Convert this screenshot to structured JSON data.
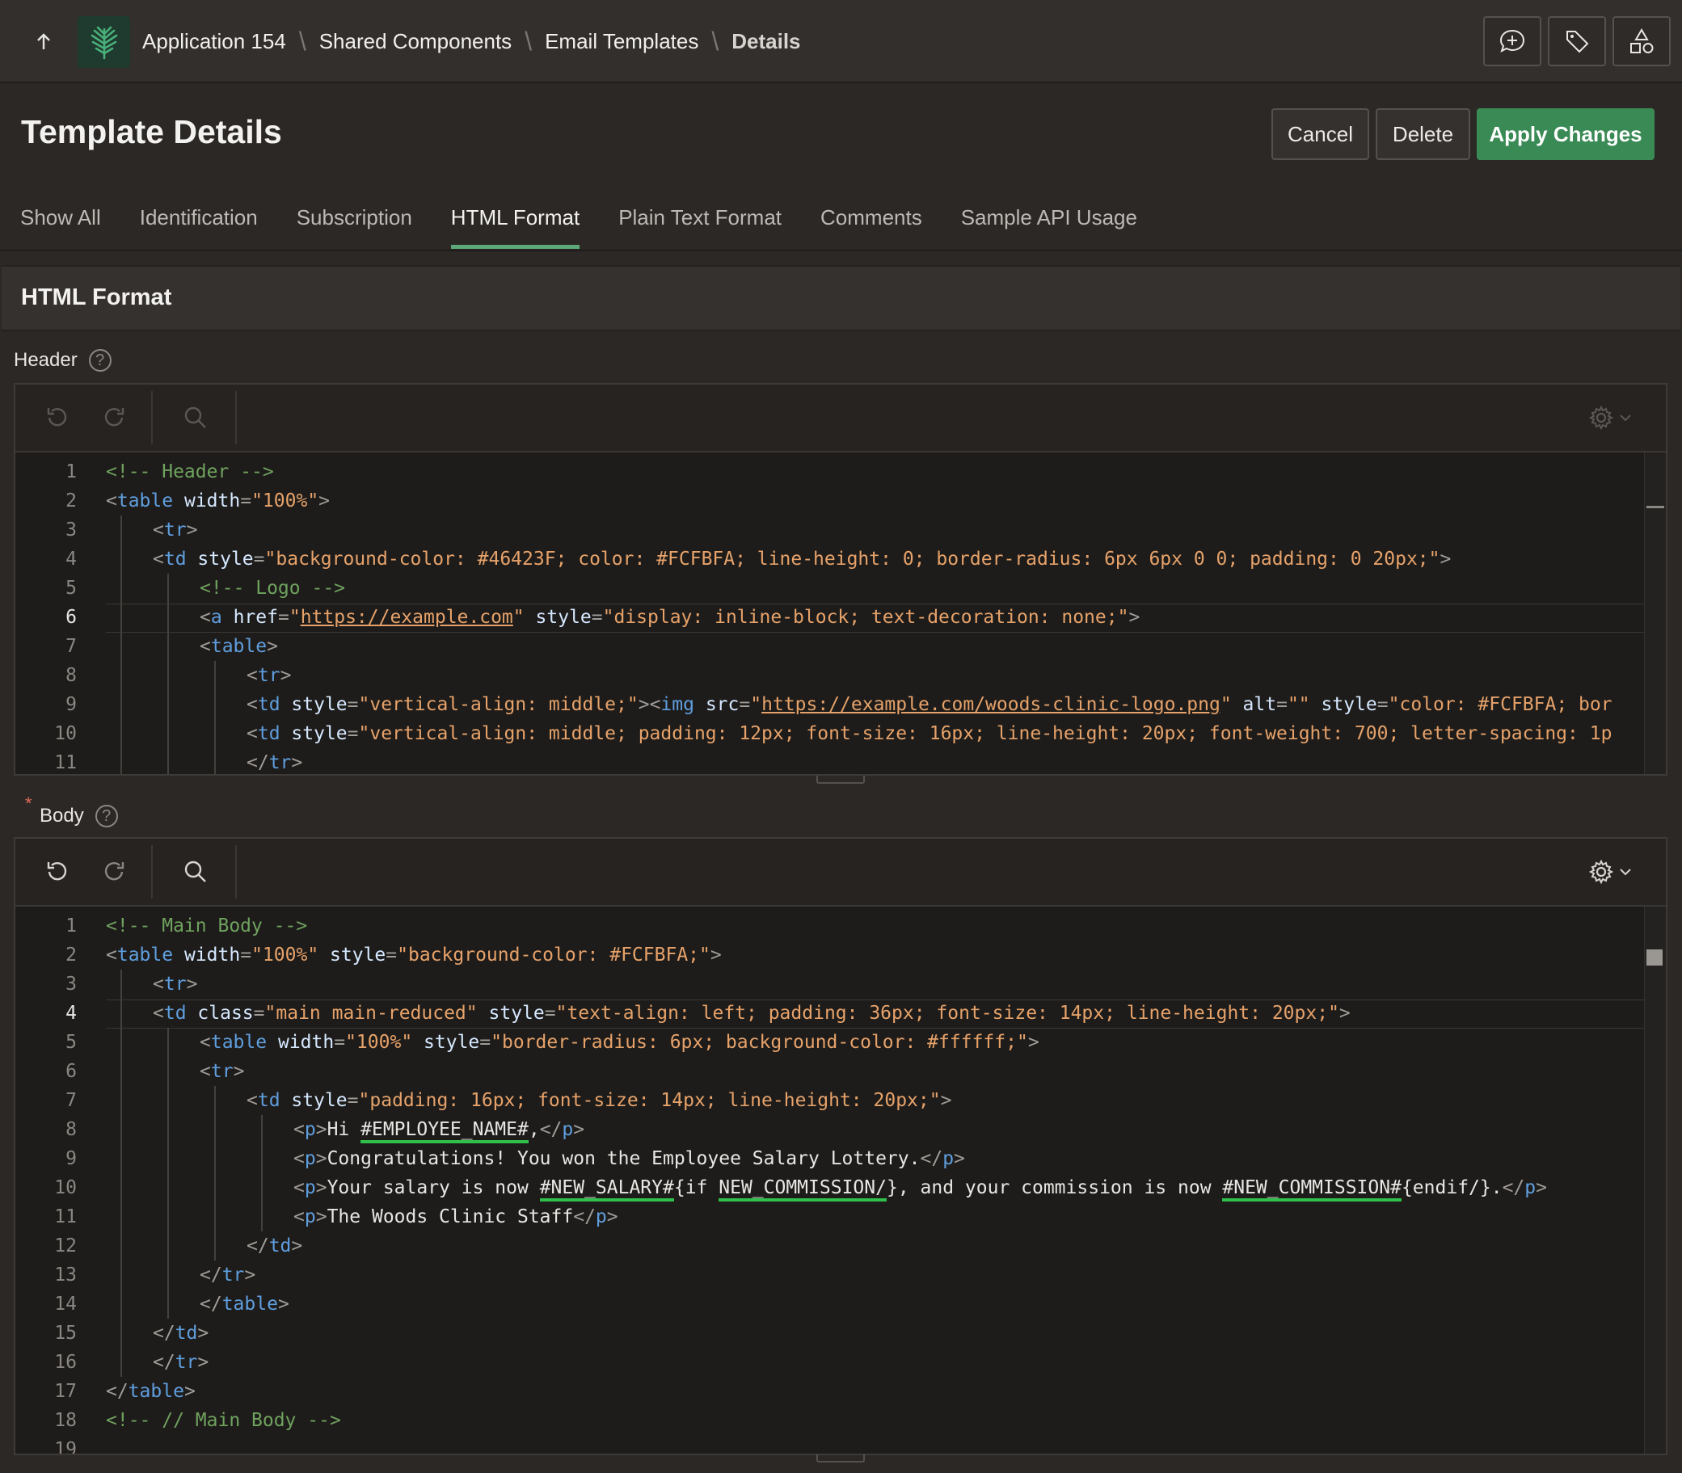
{
  "breadcrumb": {
    "items": [
      "Application 154",
      "Shared Components",
      "Email Templates"
    ],
    "current": "Details"
  },
  "top_actions": [
    "comment-add-icon",
    "tag-icon",
    "shapes-icon"
  ],
  "page": {
    "title": "Template Details",
    "cancel_label": "Cancel",
    "delete_label": "Delete",
    "apply_label": "Apply Changes"
  },
  "tabs": [
    {
      "label": "Show All"
    },
    {
      "label": "Identification"
    },
    {
      "label": "Subscription"
    },
    {
      "label": "HTML Format",
      "active": true
    },
    {
      "label": "Plain Text Format"
    },
    {
      "label": "Comments"
    },
    {
      "label": "Sample API Usage"
    }
  ],
  "region": {
    "title": "HTML Format"
  },
  "header_field": {
    "label": "Header",
    "help": "?"
  },
  "body_field": {
    "label": "Body",
    "help": "?",
    "required": "*"
  },
  "header_editor": {
    "current_line": 6,
    "lines": [
      {
        "n": "1",
        "indent": 0,
        "tokens": [
          [
            "com",
            "<!-- Header -->"
          ]
        ]
      },
      {
        "n": "2",
        "indent": 0,
        "tokens": [
          [
            "punc",
            "<"
          ],
          [
            "tag",
            "table"
          ],
          [
            "txt",
            " "
          ],
          [
            "attr",
            "width"
          ],
          [
            "punc",
            "="
          ],
          [
            "str",
            "\"100%\""
          ],
          [
            "punc",
            ">"
          ]
        ]
      },
      {
        "n": "3",
        "indent": 1,
        "tokens": [
          [
            "punc",
            "<"
          ],
          [
            "tag",
            "tr"
          ],
          [
            "punc",
            ">"
          ]
        ]
      },
      {
        "n": "4",
        "indent": 1,
        "tokens": [
          [
            "punc",
            "<"
          ],
          [
            "tag",
            "td"
          ],
          [
            "txt",
            " "
          ],
          [
            "attr",
            "style"
          ],
          [
            "punc",
            "="
          ],
          [
            "str",
            "\"background-color: #46423F; color: #FCFBFA; line-height: 0; border-radius: 6px 6px 0 0; padding: 0 20px;\""
          ],
          [
            "punc",
            ">"
          ]
        ]
      },
      {
        "n": "5",
        "indent": 2,
        "tokens": [
          [
            "com",
            "<!-- Logo -->"
          ]
        ]
      },
      {
        "n": "6",
        "indent": 2,
        "tokens": [
          [
            "punc",
            "<"
          ],
          [
            "tag",
            "a"
          ],
          [
            "txt",
            " "
          ],
          [
            "attr",
            "href"
          ],
          [
            "punc",
            "="
          ],
          [
            "str",
            "\""
          ],
          [
            "url",
            "https://example.com"
          ],
          [
            "str",
            "\""
          ],
          [
            "txt",
            " "
          ],
          [
            "attr",
            "style"
          ],
          [
            "punc",
            "="
          ],
          [
            "str",
            "\"display: inline-block; text-decoration: none;\""
          ],
          [
            "punc",
            ">"
          ]
        ]
      },
      {
        "n": "7",
        "indent": 2,
        "tokens": [
          [
            "punc",
            "<"
          ],
          [
            "tag",
            "table"
          ],
          [
            "punc",
            ">"
          ]
        ]
      },
      {
        "n": "8",
        "indent": 3,
        "tokens": [
          [
            "punc",
            "<"
          ],
          [
            "tag",
            "tr"
          ],
          [
            "punc",
            ">"
          ]
        ]
      },
      {
        "n": "9",
        "indent": 3,
        "tokens": [
          [
            "punc",
            "<"
          ],
          [
            "tag",
            "td"
          ],
          [
            "txt",
            " "
          ],
          [
            "attr",
            "style"
          ],
          [
            "punc",
            "="
          ],
          [
            "str",
            "\"vertical-align: middle;\""
          ],
          [
            "punc",
            "><"
          ],
          [
            "tag",
            "img"
          ],
          [
            "txt",
            " "
          ],
          [
            "attr",
            "src"
          ],
          [
            "punc",
            "="
          ],
          [
            "str",
            "\""
          ],
          [
            "url",
            "https://example.com/woods-clinic-logo.png"
          ],
          [
            "str",
            "\""
          ],
          [
            "txt",
            " "
          ],
          [
            "attr",
            "alt"
          ],
          [
            "punc",
            "="
          ],
          [
            "str",
            "\"\""
          ],
          [
            "txt",
            " "
          ],
          [
            "attr",
            "style"
          ],
          [
            "punc",
            "="
          ],
          [
            "str",
            "\"color: #FCFBFA; bor"
          ]
        ]
      },
      {
        "n": "10",
        "indent": 3,
        "tokens": [
          [
            "punc",
            "<"
          ],
          [
            "tag",
            "td"
          ],
          [
            "txt",
            " "
          ],
          [
            "attr",
            "style"
          ],
          [
            "punc",
            "="
          ],
          [
            "str",
            "\"vertical-align: middle; padding: 12px; font-size: 16px; line-height: 20px; font-weight: 700; letter-spacing: 1p"
          ]
        ]
      },
      {
        "n": "11",
        "indent": 3,
        "tokens": [
          [
            "punc",
            "</"
          ],
          [
            "tag",
            "tr"
          ],
          [
            "punc",
            ">"
          ]
        ]
      }
    ]
  },
  "body_editor": {
    "current_line": 4,
    "lines": [
      {
        "n": "1",
        "indent": 0,
        "tokens": [
          [
            "com",
            "<!-- Main Body -->"
          ]
        ]
      },
      {
        "n": "2",
        "indent": 0,
        "tokens": [
          [
            "punc",
            "<"
          ],
          [
            "tag",
            "table"
          ],
          [
            "txt",
            " "
          ],
          [
            "attr",
            "width"
          ],
          [
            "punc",
            "="
          ],
          [
            "str",
            "\"100%\""
          ],
          [
            "txt",
            " "
          ],
          [
            "attr",
            "style"
          ],
          [
            "punc",
            "="
          ],
          [
            "str",
            "\"background-color: #FCFBFA;\""
          ],
          [
            "punc",
            ">"
          ]
        ]
      },
      {
        "n": "3",
        "indent": 1,
        "tokens": [
          [
            "punc",
            "<"
          ],
          [
            "tag",
            "tr"
          ],
          [
            "punc",
            ">"
          ]
        ]
      },
      {
        "n": "4",
        "indent": 1,
        "tokens": [
          [
            "punc",
            "<"
          ],
          [
            "tag",
            "td"
          ],
          [
            "txt",
            " "
          ],
          [
            "attr",
            "class"
          ],
          [
            "punc",
            "="
          ],
          [
            "str",
            "\"main main-reduced\""
          ],
          [
            "txt",
            " "
          ],
          [
            "attr",
            "style"
          ],
          [
            "punc",
            "="
          ],
          [
            "str",
            "\"text-align: left; padding: 36px; font-size: 14px; line-height: 20px;\""
          ],
          [
            "punc",
            ">"
          ]
        ]
      },
      {
        "n": "5",
        "indent": 2,
        "tokens": [
          [
            "punc",
            "<"
          ],
          [
            "tag",
            "table"
          ],
          [
            "txt",
            " "
          ],
          [
            "attr",
            "width"
          ],
          [
            "punc",
            "="
          ],
          [
            "str",
            "\"100%\""
          ],
          [
            "txt",
            " "
          ],
          [
            "attr",
            "style"
          ],
          [
            "punc",
            "="
          ],
          [
            "str",
            "\"border-radius: 6px; background-color: #ffffff;\""
          ],
          [
            "punc",
            ">"
          ]
        ]
      },
      {
        "n": "6",
        "indent": 2,
        "tokens": [
          [
            "punc",
            "<"
          ],
          [
            "tag",
            "tr"
          ],
          [
            "punc",
            ">"
          ]
        ]
      },
      {
        "n": "7",
        "indent": 3,
        "tokens": [
          [
            "punc",
            "<"
          ],
          [
            "tag",
            "td"
          ],
          [
            "txt",
            " "
          ],
          [
            "attr",
            "style"
          ],
          [
            "punc",
            "="
          ],
          [
            "str",
            "\"padding: 16px; font-size: 14px; line-height: 20px;\""
          ],
          [
            "punc",
            ">"
          ]
        ]
      },
      {
        "n": "8",
        "indent": 4,
        "tokens": [
          [
            "punc",
            "<"
          ],
          [
            "tag",
            "p"
          ],
          [
            "punc",
            ">"
          ],
          [
            "txt",
            "Hi "
          ],
          [
            "sub",
            "#EMPLOYEE_NAME#"
          ],
          [
            "txt",
            ","
          ],
          [
            "punc",
            "</"
          ],
          [
            "tag",
            "p"
          ],
          [
            "punc",
            ">"
          ]
        ]
      },
      {
        "n": "9",
        "indent": 4,
        "tokens": [
          [
            "punc",
            "<"
          ],
          [
            "tag",
            "p"
          ],
          [
            "punc",
            ">"
          ],
          [
            "txt",
            "Congratulations! You won the Employee Salary Lottery."
          ],
          [
            "punc",
            "</"
          ],
          [
            "tag",
            "p"
          ],
          [
            "punc",
            ">"
          ]
        ]
      },
      {
        "n": "10",
        "indent": 4,
        "tokens": [
          [
            "punc",
            "<"
          ],
          [
            "tag",
            "p"
          ],
          [
            "punc",
            ">"
          ],
          [
            "txt",
            "Your salary is now "
          ],
          [
            "sub",
            "#NEW_SALARY#"
          ],
          [
            "txt",
            "{if "
          ],
          [
            "sub",
            "NEW_COMMISSION/"
          ],
          [
            "txt",
            "}, and your commission is now "
          ],
          [
            "sub",
            "#NEW_COMMISSION#"
          ],
          [
            "txt",
            "{endif/}."
          ],
          [
            "punc",
            "</"
          ],
          [
            "tag",
            "p"
          ],
          [
            "punc",
            ">"
          ]
        ]
      },
      {
        "n": "11",
        "indent": 4,
        "tokens": [
          [
            "punc",
            "<"
          ],
          [
            "tag",
            "p"
          ],
          [
            "punc",
            ">"
          ],
          [
            "txt",
            "The Woods Clinic Staff"
          ],
          [
            "punc",
            "</"
          ],
          [
            "tag",
            "p"
          ],
          [
            "punc",
            ">"
          ]
        ]
      },
      {
        "n": "12",
        "indent": 3,
        "tokens": [
          [
            "punc",
            "</"
          ],
          [
            "tag",
            "td"
          ],
          [
            "punc",
            ">"
          ]
        ]
      },
      {
        "n": "13",
        "indent": 2,
        "tokens": [
          [
            "punc",
            "</"
          ],
          [
            "tag",
            "tr"
          ],
          [
            "punc",
            ">"
          ]
        ]
      },
      {
        "n": "14",
        "indent": 2,
        "tokens": [
          [
            "punc",
            "</"
          ],
          [
            "tag",
            "table"
          ],
          [
            "punc",
            ">"
          ]
        ]
      },
      {
        "n": "15",
        "indent": 1,
        "tokens": [
          [
            "punc",
            "</"
          ],
          [
            "tag",
            "td"
          ],
          [
            "punc",
            ">"
          ]
        ]
      },
      {
        "n": "16",
        "indent": 1,
        "tokens": [
          [
            "punc",
            "</"
          ],
          [
            "tag",
            "tr"
          ],
          [
            "punc",
            ">"
          ]
        ]
      },
      {
        "n": "17",
        "indent": 0,
        "tokens": [
          [
            "punc",
            "</"
          ],
          [
            "tag",
            "table"
          ],
          [
            "punc",
            ">"
          ]
        ]
      },
      {
        "n": "18",
        "indent": 0,
        "tokens": [
          [
            "com",
            "<!-- // Main Body -->"
          ]
        ]
      },
      {
        "n": "19",
        "indent": 0,
        "tokens": []
      }
    ]
  },
  "colors": {
    "accent": "#3a8a55",
    "tab_underline": "#5ca878",
    "substitution_underline": "#2fbf4a"
  }
}
